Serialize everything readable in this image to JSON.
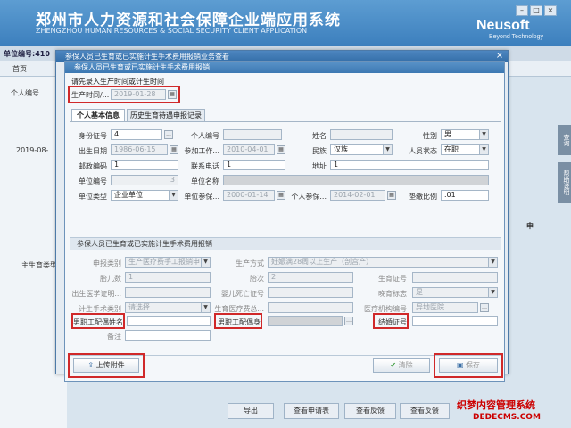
{
  "app": {
    "title": "郑州市人力资源和社会保障企业端应用系统",
    "subtitle": "ZHENGZHOU HUMAN RESOURCES & SOCIAL SECURITY CLIENT APPLICATION",
    "brand": "Neusoft",
    "brand_sub": "Beyond Technology",
    "unit_label": "单位编号:410",
    "menu_home": "首页",
    "bg_person_label": "个人编号",
    "bg_date": "2019-08-",
    "bg_row_label": "主生育类型",
    "bg_company_label": "申",
    "right_tab_1": "查询",
    "right_tab_2": "帮助说明",
    "bottom_buttons": [
      "导出",
      "查看申请表",
      "查看反馈",
      "查看反馈"
    ],
    "watermark": "织梦内容管理系统",
    "watermark2": "DEDECMS.COM"
  },
  "outer_dialog": {
    "title": "参保人员已生育或已实施计生手术费用报销业务查看",
    "close": "×"
  },
  "inner_dialog": {
    "title": "参保人员已生育或已实施计生手术费用报销",
    "hint": "请先录入生产时间或计生时间",
    "birth_time_label": "生产时间/...",
    "birth_time_value": "2019-01-28"
  },
  "tabs": [
    "个人基本信息",
    "历史生育待遇申报记录"
  ],
  "basic": {
    "id_label": "身份证号",
    "id_value": "4",
    "id_icon": "...",
    "personal_no_label": "个人编号",
    "personal_no_value": "",
    "name_label": "姓名",
    "name_value": "",
    "gender_label": "性别",
    "gender_value": "男",
    "birth_label": "出生日期",
    "birth_value": "1986-06-15",
    "work_label": "参加工作...",
    "work_value": "2010-04-01",
    "ethnic_label": "民族",
    "ethnic_value": "汉族",
    "status_label": "人员状态",
    "status_value": "在职",
    "zip_label": "邮政编码",
    "zip_value": "1",
    "phone_label": "联系电话",
    "phone_value": "1",
    "address_label": "地址",
    "address_value": "1",
    "unit_no_label": "单位编号",
    "unit_no_value": "3",
    "unit_name_label": "单位名称",
    "unit_name_value": "",
    "unit_type_label": "单位类型",
    "unit_type_value": "企业单位",
    "unit_ins_label": "单位参保...",
    "unit_ins_value": "2000-01-14",
    "person_ins_label": "个人参保...",
    "person_ins_value": "2014-02-01",
    "ratio_label": "垫缴比例",
    "ratio_value": ".01"
  },
  "reimb": {
    "section_title": "参保人员已生育或已实施计生手术费用报销",
    "type_label": "申报类别",
    "type_value": "生产医疗费手工报销申",
    "mode_label": "生产方式",
    "mode_value": "妊娠满28周以上生产（剖宫产）",
    "fetus_label": "胎儿数",
    "fetus_value": "1",
    "parity_label": "胎次",
    "parity_value": "2",
    "cert_no_label": "生育证号",
    "cert_no_value": "",
    "birth_cert_label": "出生医学证明...",
    "birth_cert_value": "",
    "death_cert_label": "婴儿死亡证号",
    "death_cert_value": "",
    "late_label": "晚育标志",
    "late_value": "是",
    "surgery_label": "计生手术类别",
    "surgery_value": "请选择",
    "hospital_label": "生育医疗费总...",
    "hospital_value": "",
    "org_label": "医疗机构编号",
    "org_value": "异地医院",
    "spouse_name_label": "男职工配偶姓名",
    "spouse_name_value": "",
    "spouse_id_label": "男职工配偶身",
    "spouse_id_value": "",
    "marriage_label": "结婚证号",
    "marriage_value": "",
    "remark_label": "备注",
    "remark_value": ""
  },
  "buttons": {
    "upload": "上传附件",
    "clear": "清除",
    "save": "保存"
  }
}
